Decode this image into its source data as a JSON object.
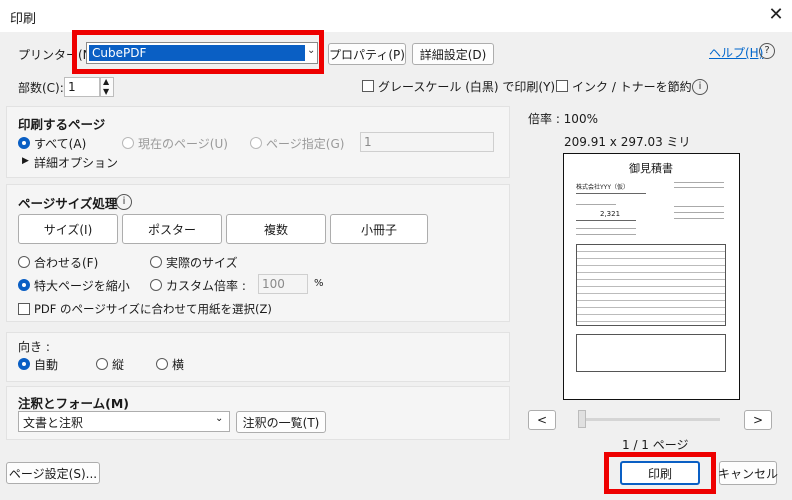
{
  "window": {
    "title": "印刷",
    "close": "✕"
  },
  "printer": {
    "label": "プリンター(N):",
    "selected": "CubePDF",
    "properties": "プロパティ(P)",
    "advanced": "詳細設定(D)",
    "help": "ヘルプ(H)",
    "copies_label": "部数(C):",
    "copies_value": "1",
    "grayscale": "グレースケール (白黒) で印刷(Y)",
    "save_ink": "インク / トナーを節約"
  },
  "pages": {
    "header": "印刷するページ",
    "all": "すべて(A)",
    "current": "現在のページ(U)",
    "specify": "ページ指定(G)",
    "range_value": "1",
    "more_options": "詳細オプション"
  },
  "sizing": {
    "header": "ページサイズ処理",
    "buttons": [
      "サイズ(I)",
      "ポスター",
      "複数",
      "小冊子"
    ],
    "fit": "合わせる(F)",
    "actual": "実際のサイズ",
    "shrink": "特大ページを縮小",
    "custom": "カスタム倍率 :",
    "custom_value": "100",
    "percent": "%",
    "pdf_paper": "PDF のページサイズに合わせて用紙を選択(Z)"
  },
  "orientation": {
    "header": "向き :",
    "auto": "自動",
    "portrait": "縦",
    "landscape": "横"
  },
  "comments": {
    "header": "注釈とフォーム(M)",
    "selected": "文書と注釈",
    "summary": "注釈の一覧(T)"
  },
  "preview": {
    "zoom": "倍率 : 100%",
    "dimensions": "209.91 x 297.03 ミリ",
    "doc_title": "御見積書",
    "company": "株式会社YYY（仮）",
    "amount": "2,321",
    "page_counter": "1 / 1 ページ",
    "prev": "<",
    "next": ">"
  },
  "footer": {
    "page_setup": "ページ設定(S)...",
    "print": "印刷",
    "cancel": "キャンセル"
  },
  "colors": {
    "accent": "#0a5fc4",
    "highlight_red": "#ee0000",
    "link": "#0066cc"
  }
}
